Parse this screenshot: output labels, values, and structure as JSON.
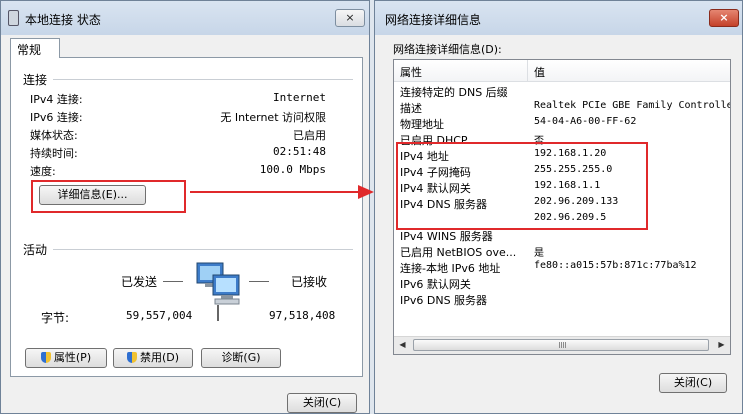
{
  "left_window": {
    "title": "本地连接 状态",
    "close_icon": "×",
    "tab_label": "常规",
    "connection": {
      "heading": "连接",
      "rows": [
        {
          "label": "IPv4 连接:",
          "value": "Internet"
        },
        {
          "label": "IPv6 连接:",
          "value": "无 Internet 访问权限"
        },
        {
          "label": "媒体状态:",
          "value": "已启用"
        },
        {
          "label": "持续时间:",
          "value": "02:51:48"
        },
        {
          "label": "速度:",
          "value": "100.0 Mbps"
        }
      ],
      "details_button": "详细信息(E)..."
    },
    "activity": {
      "heading": "活动",
      "sent_label": "已发送",
      "received_label": "已接收",
      "bytes_label": "字节:",
      "bytes_sent": "59,557,004",
      "bytes_received": "97,518,408"
    },
    "buttons": {
      "properties": "属性(P)",
      "disable": "禁用(D)",
      "diagnose": "诊断(G)",
      "close": "关闭(C)"
    }
  },
  "right_window": {
    "title": "网络连接详细信息",
    "close_icon": "×",
    "subtitle": "网络连接详细信息(D):",
    "columns": [
      "属性",
      "值"
    ],
    "rows": [
      {
        "prop": "连接特定的 DNS 后缀",
        "value": ""
      },
      {
        "prop": "描述",
        "value": "Realtek PCIe GBE Family Controller"
      },
      {
        "prop": "物理地址",
        "value": "54-04-A6-00-FF-62"
      },
      {
        "prop": "已启用 DHCP",
        "value": "否"
      },
      {
        "prop": "IPv4 地址",
        "value": "192.168.1.20"
      },
      {
        "prop": "IPv4 子网掩码",
        "value": "255.255.255.0"
      },
      {
        "prop": "IPv4 默认网关",
        "value": "192.168.1.1"
      },
      {
        "prop": "IPv4 DNS 服务器",
        "value": "202.96.209.133"
      },
      {
        "prop": "",
        "value": "202.96.209.5"
      },
      {
        "prop": "IPv4 WINS 服务器",
        "value": ""
      },
      {
        "prop": "已启用 NetBIOS ove...",
        "value": "是"
      },
      {
        "prop": "连接-本地 IPv6 地址",
        "value": "fe80::a015:57b:871c:77ba%12"
      },
      {
        "prop": "IPv6 默认网关",
        "value": ""
      },
      {
        "prop": "IPv6 DNS 服务器",
        "value": ""
      }
    ],
    "close_button": "关闭(C)"
  },
  "colors": {
    "highlight": "#e0292b",
    "titlebar": "#c7d6e8"
  }
}
